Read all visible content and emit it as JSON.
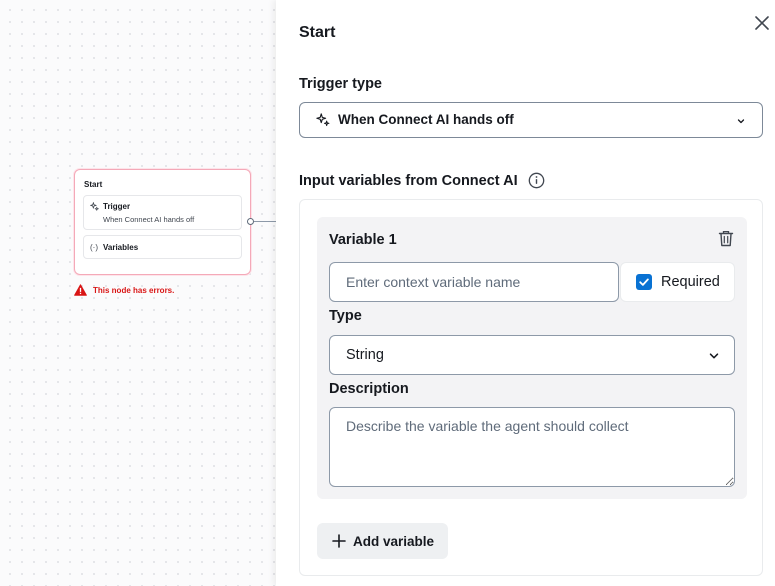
{
  "canvas": {
    "node": {
      "title": "Start",
      "trigger_label": "Trigger",
      "trigger_value": "When Connect AI hands off",
      "variables_label": "Variables",
      "variables_icon_text": "(·)",
      "error_text": "This node has errors."
    }
  },
  "panel": {
    "title": "Start",
    "trigger_type": {
      "label": "Trigger type",
      "selected": "When Connect AI hands off"
    },
    "input_variables": {
      "label": "Input variables from Connect AI",
      "variables": [
        {
          "title": "Variable 1",
          "name_placeholder": "Enter context variable name",
          "name_value": "",
          "required_label": "Required",
          "required_checked": true,
          "type_label": "Type",
          "type_value": "String",
          "description_label": "Description",
          "description_placeholder": "Describe the variable the agent should collect",
          "description_value": ""
        }
      ],
      "add_button_label": "Add variable"
    }
  },
  "colors": {
    "accent": "#0972d3",
    "error": "#d91515",
    "node_border": "#f4a9b8",
    "card_bg": "#f3f3f5"
  },
  "icons": {
    "close": "close-icon",
    "sparkle": "sparkle-icon",
    "chevron": "chevron-down-icon",
    "info": "info-icon",
    "trash": "trash-icon",
    "add": "plus-icon",
    "warning": "warning-icon"
  }
}
